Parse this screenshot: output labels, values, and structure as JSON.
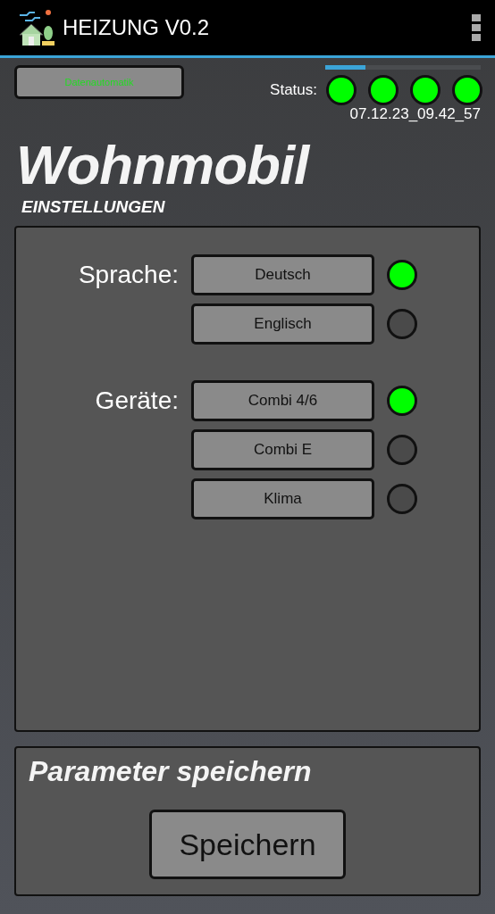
{
  "app_bar": {
    "title": "HEIZUNG V0.2"
  },
  "status": {
    "button": "Datenautomatik",
    "progress": {
      "level": 0.26
    },
    "label": "Status:",
    "lights": [
      {
        "on": true
      },
      {
        "on": true
      },
      {
        "on": true
      },
      {
        "on": true
      }
    ],
    "timestamp": "07.12.23_09.42_57"
  },
  "heading": "Wohnmobil",
  "subheading": "EINSTELLUNGEN",
  "settings": [
    {
      "label": "Sprache:",
      "options": [
        {
          "label": "Deutsch",
          "selected": true
        },
        {
          "label": "Englisch",
          "selected": false
        }
      ]
    },
    {
      "label": "Geräte:",
      "options": [
        {
          "label": "Combi 4/6",
          "selected": true
        },
        {
          "label": "Combi E",
          "selected": false
        },
        {
          "label": "Klima",
          "selected": false
        }
      ]
    }
  ],
  "save": {
    "title": "Parameter speichern",
    "button": "Speichern"
  }
}
